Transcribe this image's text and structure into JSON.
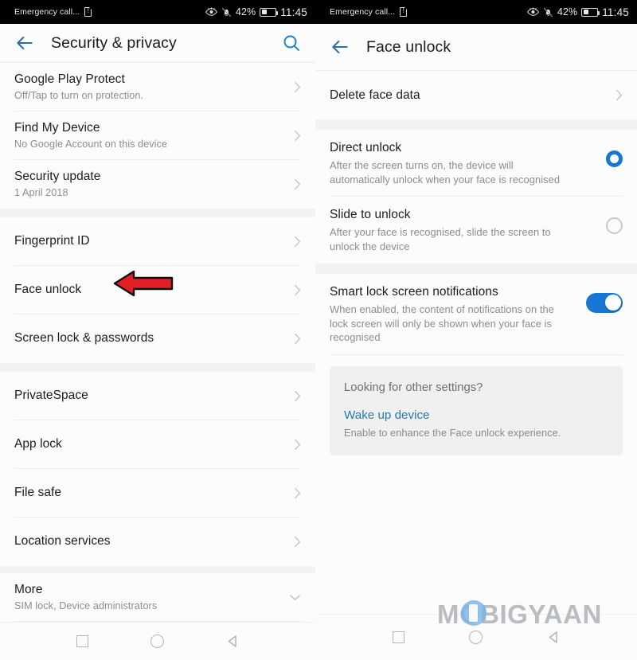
{
  "colors": {
    "accent_blue": "#1877d2",
    "appbar_icon_blue": "#2e6ea6",
    "link_blue": "#1e7bb8",
    "annotation_red": "#e31f26",
    "page_bg": "#fcfcfc",
    "section_gap": "#f2f2f2",
    "card_bg": "#f0f0f0"
  },
  "status_bar": {
    "carrier": "Emergency call...",
    "sim_icon": "sim-alert-icon",
    "eye_icon": "eye-comfort-icon",
    "bell_icon": "bell-muted-icon",
    "battery_percent": "42%",
    "battery_icon": "battery-icon",
    "battery_level": 42,
    "time": "11:45"
  },
  "left_screen": {
    "appbar": {
      "back_icon": "back-arrow-icon",
      "title": "Security & privacy",
      "search_icon": "search-icon"
    },
    "sections": [
      {
        "rows": [
          {
            "title": "Google Play Protect",
            "subtitle": "Off/Tap to turn on protection.",
            "control": "chevron-right-icon"
          },
          {
            "title": "Find My Device",
            "subtitle": "No Google Account on this device",
            "control": "chevron-right-icon"
          },
          {
            "title": "Security update",
            "subtitle": "1 April 2018",
            "control": "chevron-right-icon"
          }
        ]
      },
      {
        "rows": [
          {
            "title": "Fingerprint ID",
            "subtitle": "",
            "control": "chevron-right-icon"
          },
          {
            "title": "Face unlock",
            "subtitle": "",
            "control": "chevron-right-icon"
          },
          {
            "title": "Screen lock & passwords",
            "subtitle": "",
            "control": "chevron-right-icon"
          }
        ]
      },
      {
        "rows": [
          {
            "title": "PrivateSpace",
            "subtitle": "",
            "control": "chevron-right-icon"
          },
          {
            "title": "App lock",
            "subtitle": "",
            "control": "chevron-right-icon"
          },
          {
            "title": "File safe",
            "subtitle": "",
            "control": "chevron-right-icon"
          },
          {
            "title": "Location services",
            "subtitle": "",
            "control": "chevron-right-icon"
          }
        ]
      },
      {
        "rows": [
          {
            "title": "More",
            "subtitle": "SIM lock, Device administrators",
            "control": "chevron-down-icon"
          }
        ]
      }
    ],
    "annotation": {
      "type": "arrow-left",
      "points_to": "Face unlock",
      "color": "#e31f26"
    }
  },
  "right_screen": {
    "appbar": {
      "back_icon": "back-arrow-icon",
      "title": "Face unlock"
    },
    "delete_row": {
      "title": "Delete face data",
      "control": "chevron-right-icon"
    },
    "unlock_modes": [
      {
        "title": "Direct unlock",
        "subtitle": "After the screen turns on, the device will automatically unlock when your face is recognised",
        "selected": true
      },
      {
        "title": "Slide to unlock",
        "subtitle": "After your face is recognised, slide the screen to unlock the device",
        "selected": false
      }
    ],
    "smart_lock": {
      "title": "Smart lock screen notifications",
      "subtitle": "When enabled, the content of notifications on the lock screen will only be shown when your face is recognised",
      "enabled": true
    },
    "info_card": {
      "heading": "Looking for other settings?",
      "link": "Wake up device",
      "sub": "Enable to enhance the Face unlock experience."
    }
  },
  "navbar": {
    "recents_icon": "square-recents-icon",
    "home_icon": "circle-home-icon",
    "back_icon": "triangle-back-icon"
  },
  "watermark": {
    "text": "MOBIGYAAN"
  }
}
